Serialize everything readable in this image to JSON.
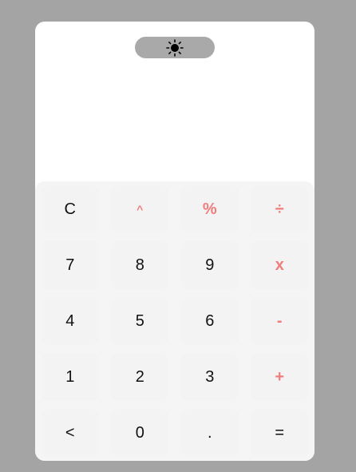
{
  "display": {
    "value": ""
  },
  "theme_toggle": {
    "icon": "sun-icon"
  },
  "colors": {
    "operator": "#f07c7c",
    "background": "#a4a4a4",
    "keypad": "#f5f5f5"
  },
  "keys": {
    "clear": "C",
    "power": "^",
    "percent": "%",
    "divide": "÷",
    "seven": "7",
    "eight": "8",
    "nine": "9",
    "multiply": "x",
    "four": "4",
    "five": "5",
    "six": "6",
    "minus": "-",
    "one": "1",
    "two": "2",
    "three": "3",
    "plus": "+",
    "backspace": "<",
    "zero": "0",
    "decimal": ".",
    "equals": "="
  }
}
